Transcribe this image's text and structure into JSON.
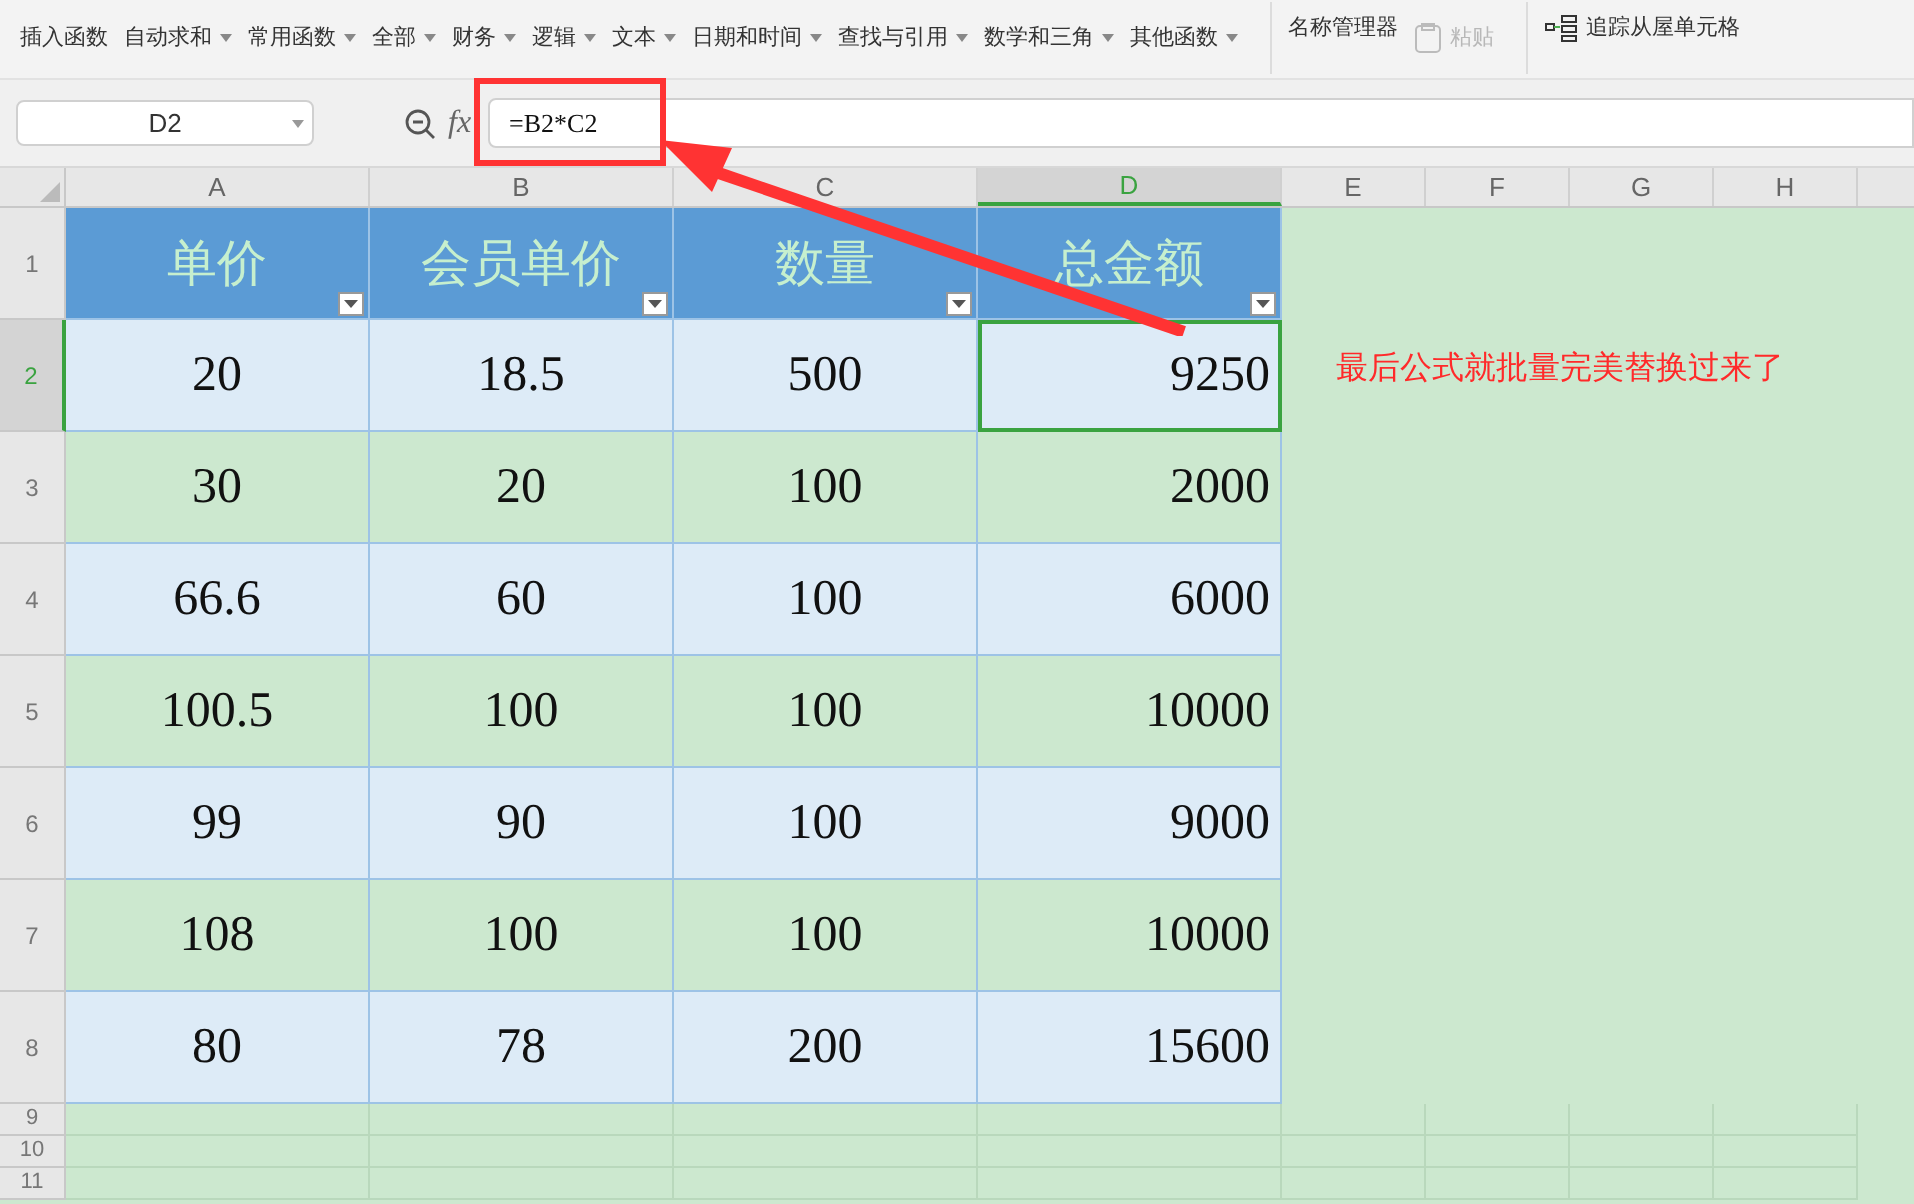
{
  "toolbar": [
    {
      "label": "插入函数",
      "dropdown": false,
      "disabled": false
    },
    {
      "label": "自动求和",
      "dropdown": true,
      "disabled": false
    },
    {
      "label": "常用函数",
      "dropdown": true,
      "disabled": false
    },
    {
      "label": "全部",
      "dropdown": true,
      "disabled": false
    },
    {
      "label": "财务",
      "dropdown": true,
      "disabled": false
    },
    {
      "label": "逻辑",
      "dropdown": true,
      "disabled": false
    },
    {
      "label": "文本",
      "dropdown": true,
      "disabled": false
    },
    {
      "label": "日期和时间",
      "dropdown": true,
      "disabled": false
    },
    {
      "label": "查找与引用",
      "dropdown": true,
      "disabled": false
    },
    {
      "label": "数学和三角",
      "dropdown": true,
      "disabled": false
    },
    {
      "label": "其他函数",
      "dropdown": true,
      "disabled": false
    },
    {
      "label": "名称管理器",
      "dropdown": false,
      "disabled": false
    },
    {
      "label": "粘贴",
      "dropdown": false,
      "disabled": true
    },
    {
      "label": "追踪从屋单元格",
      "dropdown": false,
      "disabled": false
    }
  ],
  "formula_bar": {
    "name_box": "D2",
    "fx": "fx",
    "formula": "=B2*C2"
  },
  "columns": [
    {
      "label": "A",
      "selected": false
    },
    {
      "label": "B",
      "selected": false
    },
    {
      "label": "C",
      "selected": false
    },
    {
      "label": "D",
      "selected": true
    },
    {
      "label": "E",
      "selected": false
    },
    {
      "label": "F",
      "selected": false
    },
    {
      "label": "G",
      "selected": false
    },
    {
      "label": "H",
      "selected": false
    }
  ],
  "header_row": {
    "number": "1",
    "cells": [
      "单价",
      "会员单价",
      "数量",
      "总金额"
    ]
  },
  "rows": [
    {
      "number": "2",
      "selected": true,
      "cells": [
        "20",
        "18.5",
        "500",
        "9250"
      ]
    },
    {
      "number": "3",
      "selected": false,
      "cells": [
        "30",
        "20",
        "100",
        "2000"
      ]
    },
    {
      "number": "4",
      "selected": false,
      "cells": [
        "66.6",
        "60",
        "100",
        "6000"
      ]
    },
    {
      "number": "5",
      "selected": false,
      "cells": [
        "100.5",
        "100",
        "100",
        "10000"
      ]
    },
    {
      "number": "6",
      "selected": false,
      "cells": [
        "99",
        "90",
        "100",
        "9000"
      ]
    },
    {
      "number": "7",
      "selected": false,
      "cells": [
        "108",
        "100",
        "100",
        "10000"
      ]
    },
    {
      "number": "8",
      "selected": false,
      "cells": [
        "80",
        "78",
        "200",
        "15600"
      ]
    }
  ],
  "empty_rows": [
    "9",
    "10",
    "11"
  ],
  "annotation": "最后公式就批量完美替换过来了"
}
